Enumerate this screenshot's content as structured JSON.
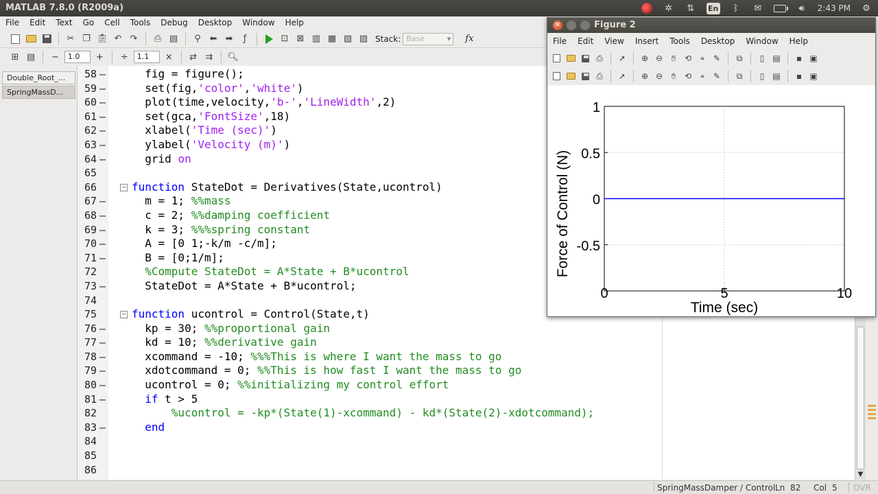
{
  "app": {
    "title": "MATLAB  7.8.0 (R2009a)",
    "clock": "2:43 PM",
    "keyboard_layout": "En"
  },
  "menubar": [
    "File",
    "Edit",
    "Text",
    "Go",
    "Cell",
    "Tools",
    "Debug",
    "Desktop",
    "Window",
    "Help"
  ],
  "toolbar": {
    "stack_label": "Stack:",
    "stack_value": "Base",
    "fx_label": "fx"
  },
  "cell_toolbar": {
    "minus": "−",
    "value1": "1.0",
    "plus": "+",
    "div": "÷",
    "value2": "1.1",
    "times": "×"
  },
  "doc_tabs": [
    "Double_Root_...",
    "SpringMassD..."
  ],
  "code_lines": [
    {
      "n": "58",
      "dash": true,
      "fold": false,
      "segs": [
        [
          "  fig = figure();",
          "n"
        ]
      ]
    },
    {
      "n": "59",
      "dash": true,
      "fold": false,
      "segs": [
        [
          "  set(fig,",
          "n"
        ],
        [
          "'color'",
          "s"
        ],
        [
          ",",
          "n"
        ],
        [
          "'white'",
          "s"
        ],
        [
          ")",
          "n"
        ]
      ]
    },
    {
      "n": "60",
      "dash": true,
      "fold": false,
      "segs": [
        [
          "  plot(time,velocity,",
          "n"
        ],
        [
          "'b-'",
          "s"
        ],
        [
          ",",
          "n"
        ],
        [
          "'LineWidth'",
          "s"
        ],
        [
          ",2)",
          "n"
        ]
      ]
    },
    {
      "n": "61",
      "dash": true,
      "fold": false,
      "segs": [
        [
          "  set(gca,",
          "n"
        ],
        [
          "'FontSize'",
          "s"
        ],
        [
          ",18)",
          "n"
        ]
      ]
    },
    {
      "n": "62",
      "dash": true,
      "fold": false,
      "segs": [
        [
          "  xlabel(",
          "n"
        ],
        [
          "'Time (sec)'",
          "s"
        ],
        [
          ")",
          "n"
        ]
      ]
    },
    {
      "n": "63",
      "dash": true,
      "fold": false,
      "segs": [
        [
          "  ylabel(",
          "n"
        ],
        [
          "'Velocity (m)'",
          "s"
        ],
        [
          ")",
          "n"
        ]
      ]
    },
    {
      "n": "64",
      "dash": true,
      "fold": false,
      "segs": [
        [
          "  grid ",
          "n"
        ],
        [
          "on",
          "s"
        ]
      ]
    },
    {
      "n": "65",
      "dash": false,
      "fold": false,
      "segs": []
    },
    {
      "n": "66",
      "dash": false,
      "fold": true,
      "segs": [
        [
          "function",
          "k"
        ],
        [
          " StateDot = Derivatives(State,ucontrol)",
          "n"
        ]
      ]
    },
    {
      "n": "67",
      "dash": true,
      "fold": false,
      "segs": [
        [
          "  m = 1; ",
          "n"
        ],
        [
          "%%mass",
          "c"
        ]
      ]
    },
    {
      "n": "68",
      "dash": true,
      "fold": false,
      "segs": [
        [
          "  c = 2; ",
          "n"
        ],
        [
          "%%damping coefficient",
          "c"
        ]
      ]
    },
    {
      "n": "69",
      "dash": true,
      "fold": false,
      "segs": [
        [
          "  k = 3; ",
          "n"
        ],
        [
          "%%%spring constant",
          "c"
        ]
      ]
    },
    {
      "n": "70",
      "dash": true,
      "fold": false,
      "segs": [
        [
          "  A = [0 1;-k/m -c/m];",
          "n"
        ]
      ]
    },
    {
      "n": "71",
      "dash": true,
      "fold": false,
      "segs": [
        [
          "  B = [0;1/m];",
          "n"
        ]
      ]
    },
    {
      "n": "72",
      "dash": false,
      "fold": false,
      "segs": [
        [
          "  %Compute StateDot = A*State + B*ucontrol",
          "c"
        ]
      ]
    },
    {
      "n": "73",
      "dash": true,
      "fold": false,
      "segs": [
        [
          "  StateDot = A*State + B*ucontrol;",
          "n"
        ]
      ]
    },
    {
      "n": "74",
      "dash": false,
      "fold": false,
      "segs": []
    },
    {
      "n": "75",
      "dash": false,
      "fold": true,
      "segs": [
        [
          "function",
          "k"
        ],
        [
          " ucontrol = Control(State,t)",
          "n"
        ]
      ]
    },
    {
      "n": "76",
      "dash": true,
      "fold": false,
      "segs": [
        [
          "  kp = 30; ",
          "n"
        ],
        [
          "%%proportional gain",
          "c"
        ]
      ]
    },
    {
      "n": "77",
      "dash": true,
      "fold": false,
      "segs": [
        [
          "  kd = 10; ",
          "n"
        ],
        [
          "%%derivative gain",
          "c"
        ]
      ]
    },
    {
      "n": "78",
      "dash": true,
      "fold": false,
      "segs": [
        [
          "  xcommand = -10; ",
          "n"
        ],
        [
          "%%%This is where I want the mass to go",
          "c"
        ]
      ]
    },
    {
      "n": "79",
      "dash": true,
      "fold": false,
      "segs": [
        [
          "  xdotcommand = 0; ",
          "n"
        ],
        [
          "%%This is how fast I want the mass to go",
          "c"
        ]
      ]
    },
    {
      "n": "80",
      "dash": true,
      "fold": false,
      "segs": [
        [
          "  ucontrol = 0; ",
          "n"
        ],
        [
          "%%initializing my control effort",
          "c"
        ]
      ]
    },
    {
      "n": "81",
      "dash": true,
      "fold": false,
      "segs": [
        [
          "  ",
          "n"
        ],
        [
          "if",
          "k"
        ],
        [
          " t > 5",
          "n"
        ]
      ]
    },
    {
      "n": "82",
      "dash": false,
      "fold": false,
      "segs": [
        [
          "      %ucontrol = -kp*(State(1)-xcommand) - kd*(State(2)-xdotcommand);",
          "c"
        ]
      ]
    },
    {
      "n": "83",
      "dash": true,
      "fold": false,
      "segs": [
        [
          "  ",
          "n"
        ],
        [
          "end",
          "k"
        ]
      ]
    },
    {
      "n": "84",
      "dash": false,
      "fold": false,
      "segs": []
    },
    {
      "n": "85",
      "dash": false,
      "fold": false,
      "segs": []
    },
    {
      "n": "86",
      "dash": false,
      "fold": false,
      "segs": []
    }
  ],
  "status": {
    "path": "SpringMassDamper / Control",
    "ln_label": "Ln",
    "ln_value": "82",
    "col_label": "Col",
    "col_value": "5",
    "ovr": "OVR"
  },
  "figure": {
    "title": "Figure 2",
    "menu": [
      "File",
      "Edit",
      "View",
      "Insert",
      "Tools",
      "Desktop",
      "Window",
      "Help"
    ]
  },
  "chart_data": {
    "type": "line",
    "xlabel": "Time (sec)",
    "ylabel": "Force of Control (N)",
    "x_ticks": [
      "0",
      "5",
      "10"
    ],
    "y_ticks": [
      "-0.5",
      "0",
      "0.5",
      "1"
    ],
    "xlim": [
      0,
      10
    ],
    "ylim": [
      -1,
      1
    ],
    "grid": true,
    "series": [
      {
        "x": [
          0,
          10
        ],
        "y": [
          0,
          0
        ],
        "color": "#0000ff"
      }
    ]
  },
  "colors": {
    "keyword": "#0000ff",
    "string": "#a020f0",
    "comment": "#228b22"
  }
}
